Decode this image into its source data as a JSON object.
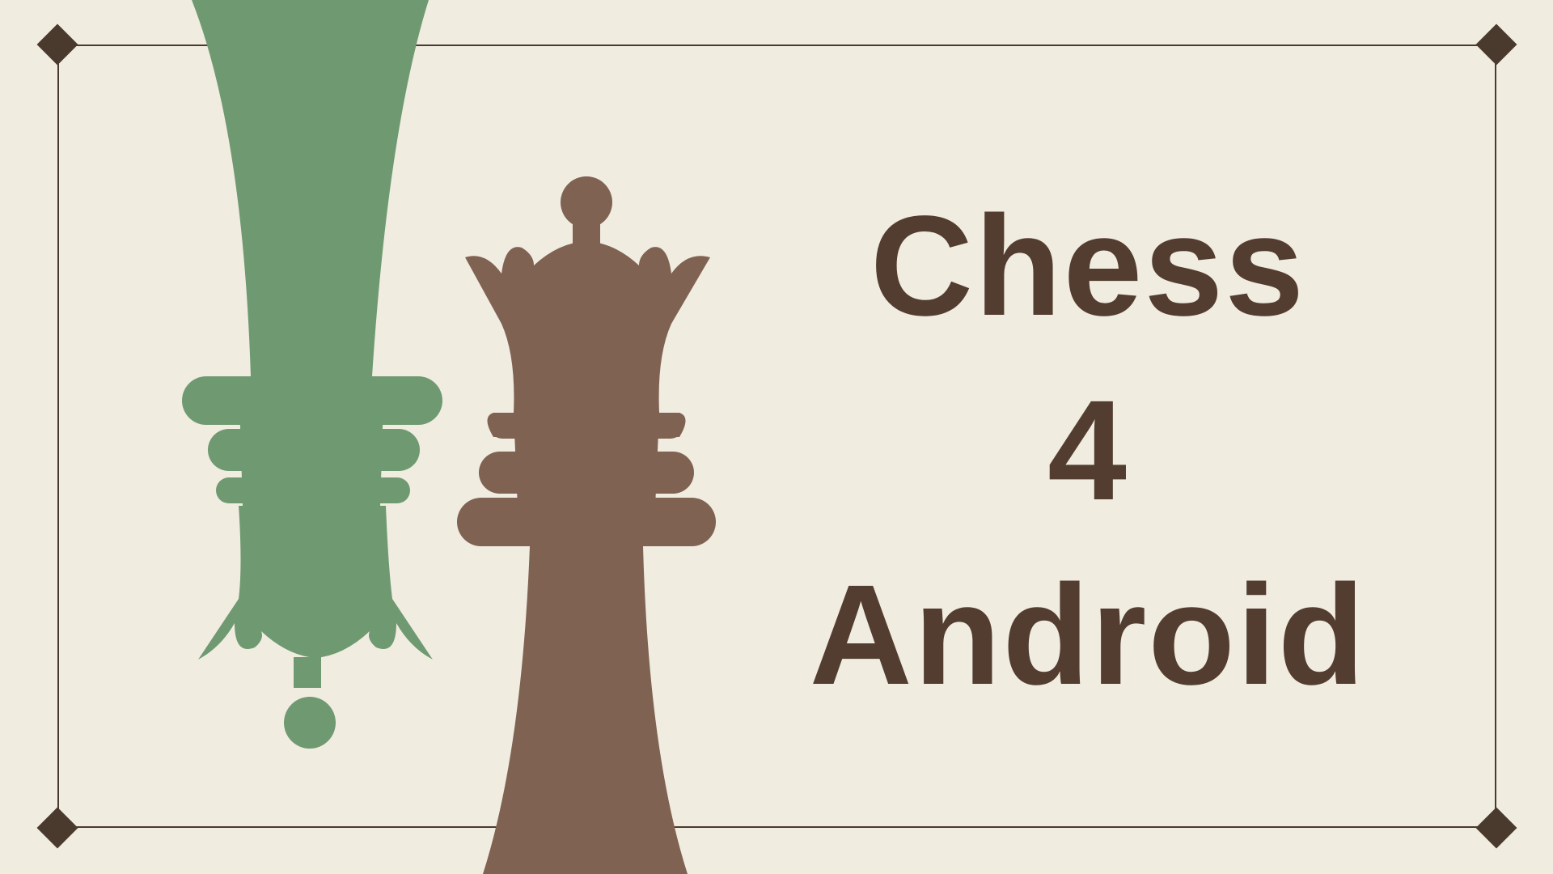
{
  "title": {
    "line1": "Chess",
    "line2": "4",
    "line3": "Android"
  },
  "colors": {
    "background": "#f1ece0",
    "frame": "#4a3a2e",
    "title_text": "#533d31",
    "green_piece": "#6f9a71",
    "brown_piece": "#7f6252"
  },
  "pieces": [
    {
      "name": "queen",
      "orientation": "inverted",
      "color": "green"
    },
    {
      "name": "queen",
      "orientation": "upright",
      "color": "brown"
    }
  ]
}
